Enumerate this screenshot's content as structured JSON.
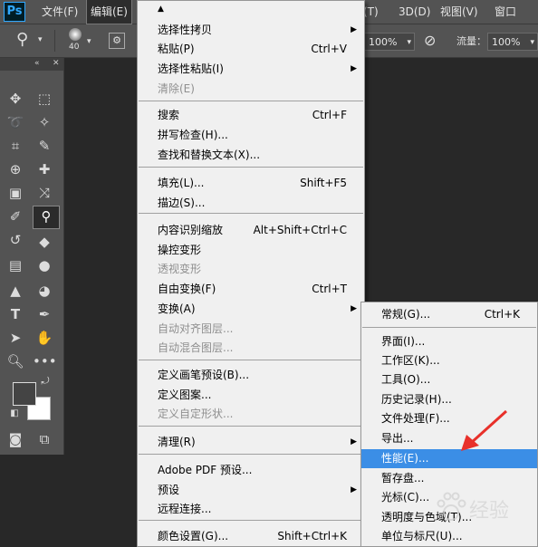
{
  "app": {
    "logo": "Ps"
  },
  "menubar": {
    "file": "文件(F)",
    "edit": "编辑(E)",
    "right_items": [
      "(T)",
      "3D(D)",
      "视图(V)",
      "窗口(W)"
    ]
  },
  "options_bar": {
    "brush_size": "40",
    "opacity_value": "100%",
    "flow_label": "流量：",
    "flow_value": "100%"
  },
  "edit_menu": {
    "scroll_up": "▲",
    "items": [
      {
        "label": "选择性拷贝",
        "shortcut": "",
        "submenu": true,
        "disabled": false
      },
      {
        "label": "粘贴(P)",
        "shortcut": "Ctrl+V",
        "submenu": false,
        "disabled": false
      },
      {
        "label": "选择性粘贴(I)",
        "shortcut": "",
        "submenu": true,
        "disabled": false
      },
      {
        "label": "清除(E)",
        "shortcut": "",
        "submenu": false,
        "disabled": true
      },
      {
        "label": "搜索",
        "shortcut": "Ctrl+F",
        "submenu": false,
        "disabled": false
      },
      {
        "label": "拼写检查(H)...",
        "shortcut": "",
        "submenu": false,
        "disabled": false
      },
      {
        "label": "查找和替换文本(X)...",
        "shortcut": "",
        "submenu": false,
        "disabled": false
      },
      {
        "label": "填充(L)...",
        "shortcut": "Shift+F5",
        "submenu": false,
        "disabled": false
      },
      {
        "label": "描边(S)...",
        "shortcut": "",
        "submenu": false,
        "disabled": false
      },
      {
        "label": "内容识别缩放",
        "shortcut": "Alt+Shift+Ctrl+C",
        "submenu": false,
        "disabled": false
      },
      {
        "label": "操控变形",
        "shortcut": "",
        "submenu": false,
        "disabled": false
      },
      {
        "label": "透视变形",
        "shortcut": "",
        "submenu": false,
        "disabled": true
      },
      {
        "label": "自由变换(F)",
        "shortcut": "Ctrl+T",
        "submenu": false,
        "disabled": false
      },
      {
        "label": "变换(A)",
        "shortcut": "",
        "submenu": true,
        "disabled": false
      },
      {
        "label": "自动对齐图层...",
        "shortcut": "",
        "submenu": false,
        "disabled": true
      },
      {
        "label": "自动混合图层...",
        "shortcut": "",
        "submenu": false,
        "disabled": true
      },
      {
        "label": "定义画笔预设(B)...",
        "shortcut": "",
        "submenu": false,
        "disabled": false
      },
      {
        "label": "定义图案...",
        "shortcut": "",
        "submenu": false,
        "disabled": false
      },
      {
        "label": "定义自定形状...",
        "shortcut": "",
        "submenu": false,
        "disabled": true
      },
      {
        "label": "清理(R)",
        "shortcut": "",
        "submenu": true,
        "disabled": false
      },
      {
        "label": "Adobe PDF 预设...",
        "shortcut": "",
        "submenu": false,
        "disabled": false
      },
      {
        "label": "预设",
        "shortcut": "",
        "submenu": true,
        "disabled": false
      },
      {
        "label": "远程连接...",
        "shortcut": "",
        "submenu": false,
        "disabled": false
      },
      {
        "label": "颜色设置(G)...",
        "shortcut": "Shift+Ctrl+K",
        "submenu": false,
        "disabled": false
      }
    ]
  },
  "prefs_submenu": {
    "items": [
      {
        "label": "常规(G)...",
        "shortcut": "Ctrl+K",
        "highlighted": false
      },
      {
        "label": "界面(I)...",
        "shortcut": "",
        "highlighted": false
      },
      {
        "label": "工作区(K)...",
        "shortcut": "",
        "highlighted": false
      },
      {
        "label": "工具(O)...",
        "shortcut": "",
        "highlighted": false
      },
      {
        "label": "历史记录(H)...",
        "shortcut": "",
        "highlighted": false
      },
      {
        "label": "文件处理(F)...",
        "shortcut": "",
        "highlighted": false
      },
      {
        "label": "导出...",
        "shortcut": "",
        "highlighted": false
      },
      {
        "label": "性能(E)...",
        "shortcut": "",
        "highlighted": true
      },
      {
        "label": "暂存盘...",
        "shortcut": "",
        "highlighted": false
      },
      {
        "label": "光标(C)...",
        "shortcut": "",
        "highlighted": false
      },
      {
        "label": "透明度与色域(T)...",
        "shortcut": "",
        "highlighted": false
      },
      {
        "label": "单位与标尺(U)...",
        "shortcut": "",
        "highlighted": false
      }
    ]
  },
  "colors": {
    "highlight": "#3b8ee6",
    "annotation_arrow": "#e8302a"
  },
  "icons": [
    "move-icon",
    "marquee-icon",
    "lasso-icon",
    "magic-wand-icon",
    "crop-icon",
    "eyedropper-icon",
    "healing-icon",
    "brush-icon",
    "clone-stamp-icon",
    "eraser-icon",
    "gradient-icon",
    "blur-icon",
    "pen-icon",
    "type-icon",
    "path-select-icon",
    "hand-icon",
    "zoom-icon",
    "more-icon"
  ],
  "watermark": {
    "text": "经验"
  }
}
